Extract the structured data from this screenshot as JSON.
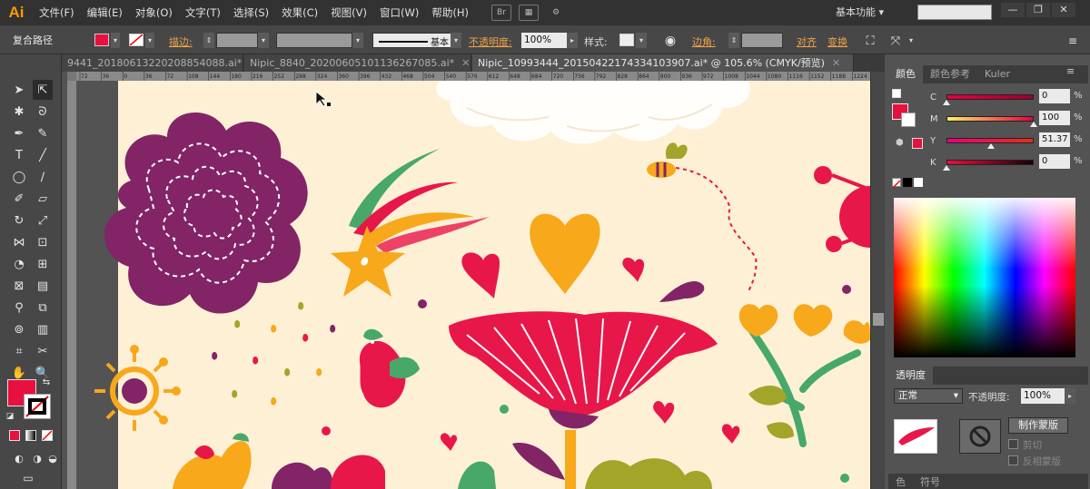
{
  "app": {
    "logo": "Ai"
  },
  "menu": [
    "文件(F)",
    "编辑(E)",
    "对象(O)",
    "文字(T)",
    "选择(S)",
    "效果(C)",
    "视图(V)",
    "窗口(W)",
    "帮助(H)"
  ],
  "menubar_icons": [
    "Br"
  ],
  "workspace": "基本功能",
  "window_buttons": [
    "—",
    "❐",
    "✕"
  ],
  "control": {
    "selection_type": "复合路径",
    "stroke_label": "描边:",
    "stroke_profile": "基本",
    "opacity_label": "不透明度:",
    "opacity_value": "100%",
    "style_label": "样式:",
    "corner_label": "边角:",
    "align_label": "对齐",
    "transform_label": "变换",
    "fill_color": "#e8103f"
  },
  "doc_tabs": [
    {
      "label": "9441_20180613220208854088.ai*",
      "close": "✕"
    },
    {
      "label": "Nipic_8840_20200605101136267085.ai*",
      "close": "✕"
    },
    {
      "label": "Nipic_10993444_20150422174334103907.ai* @ 105.6% (CMYK/预览)",
      "close": "✕"
    }
  ],
  "ruler_ticks": [
    "72",
    "36",
    "0",
    "36",
    "72",
    "108",
    "144",
    "180",
    "216",
    "252",
    "288",
    "324",
    "360",
    "396",
    "432",
    "468",
    "504",
    "540",
    "576",
    "612",
    "648",
    "684",
    "720",
    "756",
    "792",
    "828",
    "864",
    "900",
    "936",
    "972",
    "1008",
    "1044",
    "1080",
    "1116",
    "1152",
    "1188",
    "1224"
  ],
  "color_panel": {
    "tabs": [
      "颜色",
      "颜色参考",
      "Kuler"
    ],
    "sliders": [
      {
        "label": "C",
        "value": "0",
        "unit": "%",
        "fraction": 0.0,
        "gradient": "linear-gradient(to right, #e8003c, #9a0030)"
      },
      {
        "label": "M",
        "value": "100",
        "unit": "%",
        "fraction": 1.0,
        "gradient": "linear-gradient(to right, #fff066, #e8003c)"
      },
      {
        "label": "Y",
        "value": "51.37",
        "unit": "%",
        "fraction": 0.51,
        "gradient": "linear-gradient(to right, #e8007e, #e82c1a)"
      },
      {
        "label": "K",
        "value": "0",
        "unit": "%",
        "fraction": 0.0,
        "gradient": "linear-gradient(to right, #e8103f, #1a0006)"
      }
    ]
  },
  "transparency_panel": {
    "tab": "透明度",
    "blend_mode": "正常",
    "opacity_label": "不透明度:",
    "opacity_value": "100%",
    "make_mask": "制作蒙版",
    "clip": "剪切",
    "invert_mask": "反相蒙版"
  },
  "bottom_tabs": [
    "色",
    "符号"
  ],
  "colors": {
    "artboard": "#fdf0d5",
    "purple": "#822466",
    "red": "#e8174a",
    "orange": "#f7a81b",
    "green": "#47a86a",
    "olive": "#a3a52a"
  }
}
